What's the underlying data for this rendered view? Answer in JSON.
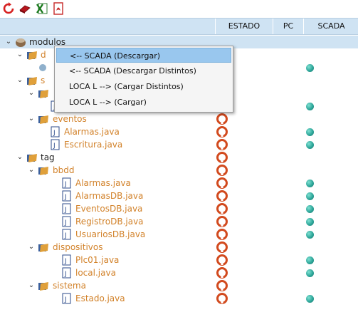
{
  "toolbar": {
    "buttons": [
      "refresh-icon",
      "eraser-icon",
      "excel-icon",
      "pdf-icon"
    ]
  },
  "header": {
    "columns": [
      "ESTADO",
      "PC",
      "SCADA"
    ]
  },
  "tree": {
    "root": "modulos",
    "r1_partial": "d",
    "r3_partial": "s",
    "eventos": "eventos",
    "alarmas_java": "Alarmas.java",
    "escritura_java": "Escritura.java",
    "tag": "tag",
    "bbdd": "bbdd",
    "alarmas_java_2": "Alarmas.java",
    "alarmasdb_java": "AlarmasDB.java",
    "eventosdb_java": "EventosDB.java",
    "registrodb_java": "RegistroDB.java",
    "usuariosdb_java": "UsuariosDB.java",
    "dispositivos": "dispositivos",
    "plc01_java": "Plc01.java",
    "local_java": "local.java",
    "sistema": "sistema",
    "estado_java": "Estado.java"
  },
  "context_menu": {
    "items": [
      "<-- SCADA (Descargar)",
      "<-- SCADA (Descargar Distintos)",
      "LOCA L --> (Cargar Distintos)",
      "LOCA L --> (Cargar)"
    ]
  },
  "colors": {
    "header_bg": "#cfe3f3",
    "folder_text": "#d2822a",
    "scada_dot": "#2ea79a",
    "estado_icon": "#d24a1e"
  }
}
